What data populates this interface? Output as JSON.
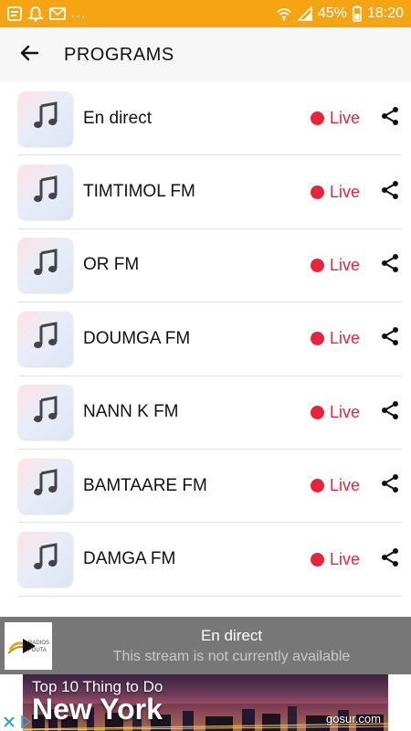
{
  "colors": {
    "statusbar": "#f4a511",
    "live": "#e8243a",
    "player_bg": "#777777"
  },
  "statusbar": {
    "icons_left": [
      "notification-icon",
      "bell-icon",
      "mail-icon"
    ],
    "dots": "...",
    "battery": "45%",
    "time": "18:20"
  },
  "header": {
    "back_icon": "arrow-left-icon",
    "title": "PROGRAMS"
  },
  "programs": [
    {
      "title": "En direct",
      "status": "Live"
    },
    {
      "title": "TIMTIMOL FM",
      "status": "Live"
    },
    {
      "title": "OR FM",
      "status": "Live"
    },
    {
      "title": "DOUMGA FM",
      "status": "Live"
    },
    {
      "title": "NANN K FM",
      "status": "Live"
    },
    {
      "title": "BAMTAARE FM",
      "status": "Live"
    },
    {
      "title": "DAMGA FM",
      "status": "Live"
    }
  ],
  "player": {
    "title": "En direct",
    "subtitle": "This stream is not currently available"
  },
  "ad": {
    "headline": "Top 10 Thing to Do",
    "city": "New York",
    "domain": "gosur.com"
  }
}
